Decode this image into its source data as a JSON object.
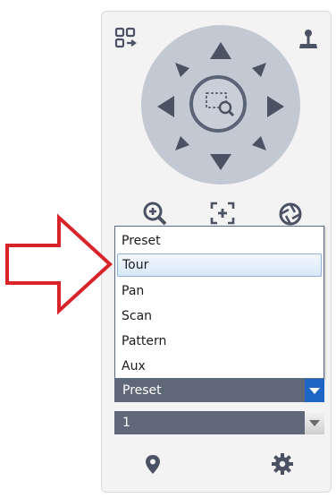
{
  "ptz_menu": {
    "items": [
      {
        "label": "Preset",
        "selected": false
      },
      {
        "label": "Tour",
        "selected": true
      },
      {
        "label": "Pan",
        "selected": false
      },
      {
        "label": "Scan",
        "selected": false
      },
      {
        "label": "Pattern",
        "selected": false
      },
      {
        "label": "Aux",
        "selected": false
      }
    ]
  },
  "function_select": {
    "value": "Preset"
  },
  "number_select": {
    "value": "1"
  },
  "icons": {
    "top_left": "layout-switch-icon",
    "top_right": "joystick-icon",
    "zoom": "zoom-in-icon",
    "focus": "focus-icon",
    "iris": "iris-icon",
    "bottom_left": "location-pin-icon",
    "bottom_right": "settings-gear-icon"
  },
  "colors": {
    "highlight_arrow": "#d9232a",
    "ptz_disc": "#c2c9d3",
    "control_dark": "#4a5263",
    "select_bg": "#5e6878",
    "select_accent": "#1f66c4"
  }
}
